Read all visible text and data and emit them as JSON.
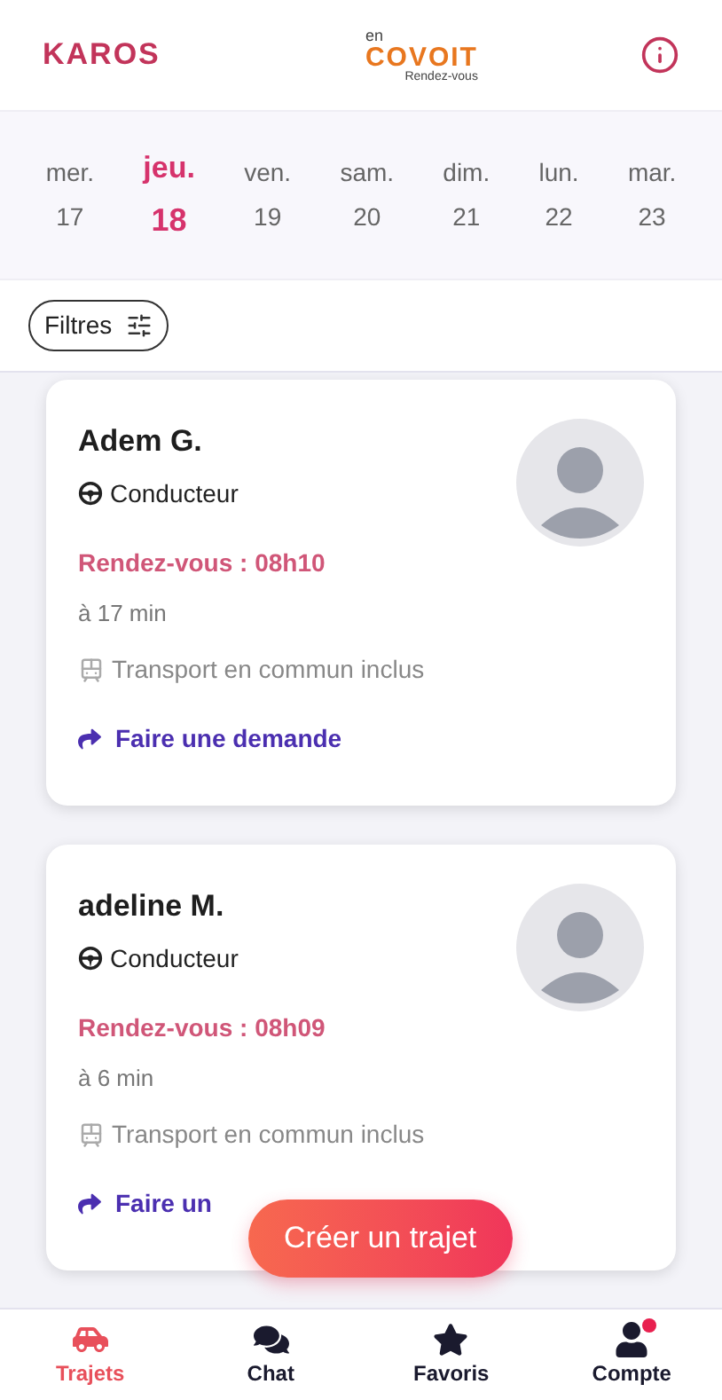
{
  "header": {
    "brand": "KAROS",
    "logo": {
      "top": "en",
      "main": "COVOIT",
      "sub": "Rendez-vous"
    }
  },
  "days": [
    {
      "weekday": "mer.",
      "date": "17",
      "selected": false
    },
    {
      "weekday": "jeu.",
      "date": "18",
      "selected": true
    },
    {
      "weekday": "ven.",
      "date": "19",
      "selected": false
    },
    {
      "weekday": "sam.",
      "date": "20",
      "selected": false
    },
    {
      "weekday": "dim.",
      "date": "21",
      "selected": false
    },
    {
      "weekday": "lun.",
      "date": "22",
      "selected": false
    },
    {
      "weekday": "mar.",
      "date": "23",
      "selected": false
    }
  ],
  "filter_button": "Filtres",
  "trips": [
    {
      "name": "Adem G.",
      "role": "Conducteur",
      "meeting": "Rendez-vous : 08h10",
      "distance": "à 17 min",
      "transit": "Transport en commun inclus",
      "action": "Faire une demande"
    },
    {
      "name": "adeline M.",
      "role": "Conducteur",
      "meeting": "Rendez-vous : 08h09",
      "distance": "à 6 min",
      "transit": "Transport en commun inclus",
      "action": "Faire un"
    }
  ],
  "create_button": "Créer un trajet",
  "nav": [
    {
      "kind": "car",
      "label": "Trajets",
      "selected": true,
      "notification": false
    },
    {
      "kind": "chat",
      "label": "Chat",
      "selected": false,
      "notification": false
    },
    {
      "kind": "star",
      "label": "Favoris",
      "selected": false,
      "notification": false
    },
    {
      "kind": "user",
      "label": "Compte",
      "selected": false,
      "notification": true
    }
  ]
}
